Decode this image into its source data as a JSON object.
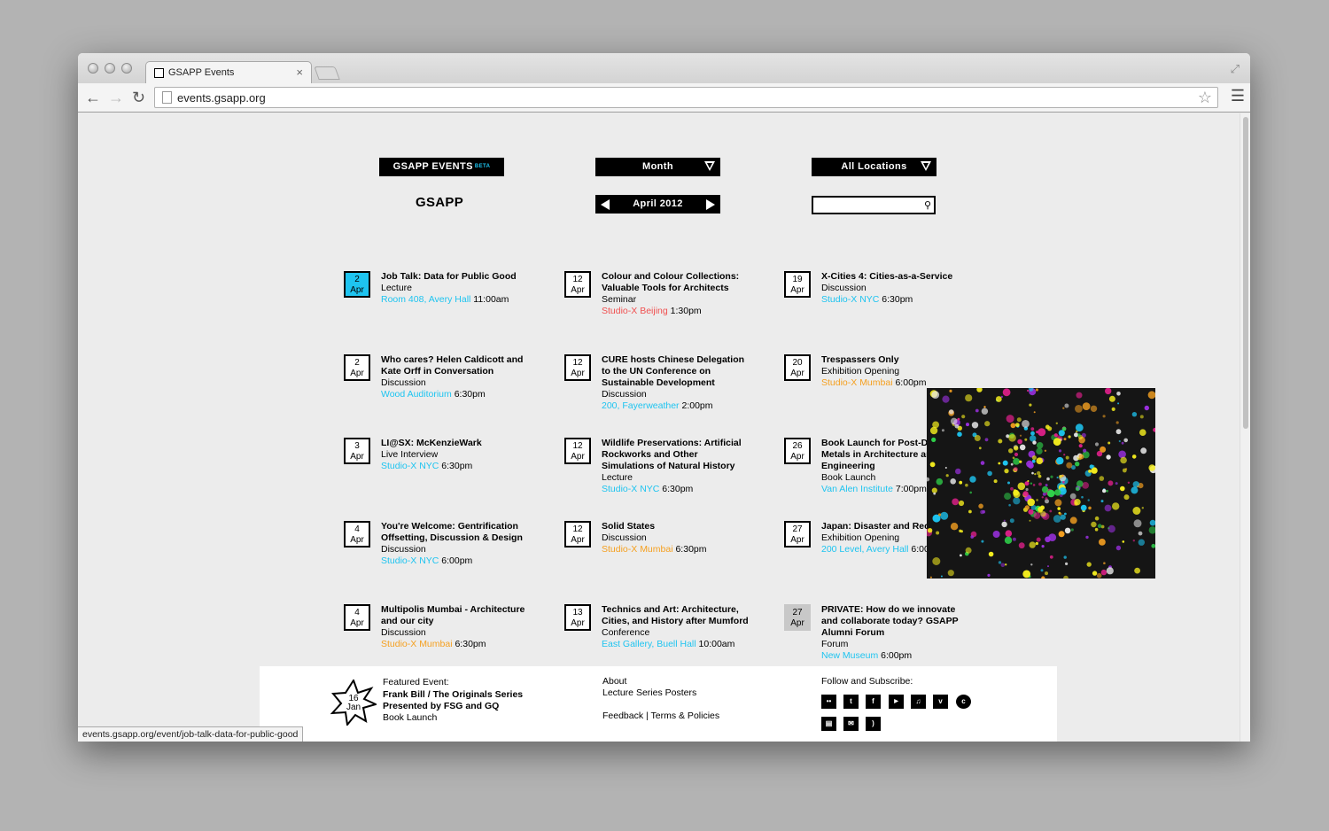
{
  "browser": {
    "tab_title": "GSAPP Events",
    "tab_close": "×",
    "url": "events.gsapp.org",
    "status_url": "events.gsapp.org/event/job-talk-data-for-public-good"
  },
  "header": {
    "brand": "GSAPP EVENTS",
    "beta": "BETA",
    "logo": "GSAPP",
    "view_select": "Month",
    "period": "April 2012",
    "location_select": "All Locations",
    "search_value": ""
  },
  "colors": {
    "accent": "#1ec4f0",
    "beijing": "#f05050",
    "mumbai": "#f5a020"
  },
  "events": [
    {
      "day": "2",
      "month": "Apr",
      "title": "Job Talk: Data for Public Good",
      "type": "Lecture",
      "location": "Room 408, Avery Hall",
      "time": "11:00am"
    },
    {
      "day": "2",
      "month": "Apr",
      "title": "Who cares? Helen Caldicott and Kate Orff in Conversation",
      "type": "Discussion",
      "location": "Wood Auditorium",
      "time": "6:30pm"
    },
    {
      "day": "3",
      "month": "Apr",
      "title": "LI@SX: McKenzieWark",
      "type": "Live Interview",
      "location": "Studio-X NYC",
      "time": "6:30pm"
    },
    {
      "day": "4",
      "month": "Apr",
      "title": "You're Welcome: Gentrification Offsetting, Discussion & Design",
      "type": "Discussion",
      "location": "Studio-X NYC",
      "time": "6:00pm"
    },
    {
      "day": "4",
      "month": "Apr",
      "title": "Multipolis Mumbai - Architecture and our city",
      "type": "Discussion",
      "location": "Studio-X Mumbai",
      "time": "6:30pm"
    },
    {
      "day": "12",
      "month": "Apr",
      "title": "Colour and Colour Collections: Valuable Tools for Architects",
      "type": "Seminar",
      "location": "Studio-X Beijing",
      "time": "1:30pm"
    },
    {
      "day": "12",
      "month": "Apr",
      "title": "CURE hosts Chinese Delegation to the UN Conference on Sustainable Development",
      "type": "Discussion",
      "location": "200, Fayerweather",
      "time": "2:00pm"
    },
    {
      "day": "12",
      "month": "Apr",
      "title": "Wildlife Preservations: Artificial Rockworks and Other Simulations of Natural History",
      "type": "Lecture",
      "location": "Studio-X NYC",
      "time": "6:30pm"
    },
    {
      "day": "12",
      "month": "Apr",
      "title": "Solid States",
      "type": "Discussion",
      "location": "Studio-X Mumbai",
      "time": "6:30pm"
    },
    {
      "day": "13",
      "month": "Apr",
      "title": "Technics and Art: Architecture, Cities, and History after Mumford",
      "type": "Conference",
      "location": "East Gallery, Buell Hall",
      "time": "10:00am"
    },
    {
      "day": "19",
      "month": "Apr",
      "title": "X-Cities 4: Cities-as-a-Service",
      "type": "Discussion",
      "location": "Studio-X NYC",
      "time": "6:30pm"
    },
    {
      "day": "20",
      "month": "Apr",
      "title": "Trespassers Only",
      "type": "Exhibition Opening",
      "location": "Studio-X Mumbai",
      "time": "6:00pm"
    },
    {
      "day": "26",
      "month": "Apr",
      "title": "Book Launch for Post-Ductility: Metals in Architecture and Engineering",
      "type": "Book Launch",
      "location": "Van Alen Institute",
      "time": "7:00pm"
    },
    {
      "day": "27",
      "month": "Apr",
      "title": "Japan: Disaster and Recovery",
      "type": "Exhibition Opening",
      "location": "200 Level, Avery Hall",
      "time": "6:00pm"
    },
    {
      "day": "27",
      "month": "Apr",
      "title": "PRIVATE: How do we innovate and collaborate today? GSAPP Alumni Forum",
      "type": "Forum",
      "location": "New Museum",
      "time": "6:00pm"
    }
  ],
  "footer": {
    "featured_label": "Featured Event:",
    "featured_day": "16",
    "featured_month": "Jan",
    "featured_title": "Frank Bill / The Originals Series Presented by FSG and GQ",
    "featured_type": "Book Launch",
    "about": "About",
    "lecture_posters": "Lecture Series Posters",
    "feedback": "Feedback",
    "sep": "|",
    "terms": "Terms & Policies",
    "follow_label": "Follow and Subscribe:",
    "social_icons": [
      "flickr",
      "tumblr",
      "facebook",
      "youtube",
      "itunes",
      "vimeo",
      "copyright",
      "newsletter",
      "email",
      "rss"
    ]
  }
}
